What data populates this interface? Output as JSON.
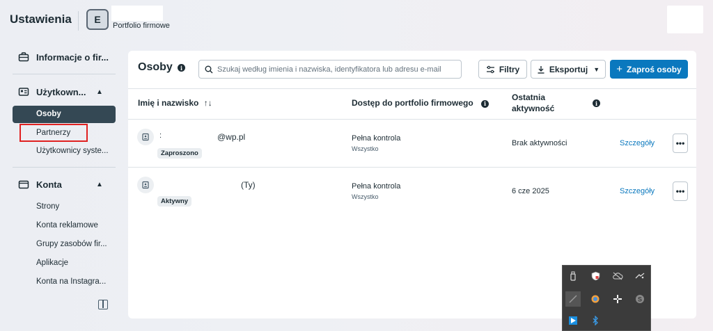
{
  "header": {
    "title": "Ustawienia",
    "avatar_letter": "E",
    "portfolio_label": "Portfolio firmowe"
  },
  "sidebar": {
    "business_info": "Informacje o fir...",
    "users_section": "Użytkown...",
    "users_items": [
      "Osoby",
      "Partnerzy",
      "Użytkownicy syste..."
    ],
    "accounts_section": "Konta",
    "accounts_items": [
      "Strony",
      "Konta reklamowe",
      "Grupy zasobów fir...",
      "Aplikacje",
      "Konta na Instagra..."
    ]
  },
  "panel": {
    "title": "Osoby",
    "search_placeholder": "Szukaj według imienia i nazwiska, identyfikatora lub adresu e-mail",
    "filters_label": "Filtry",
    "export_label": "Eksportuj",
    "invite_label": "Zaproś osoby",
    "columns": {
      "name": "Imię i nazwisko",
      "name_sort": "↑↓",
      "access": "Dostęp do portfolio firmowego",
      "last_activity_1": "Ostatnia",
      "last_activity_2": "aktywność"
    },
    "rows": [
      {
        "prefix": ":",
        "email": "@wp.pl",
        "status": "Zaproszono",
        "access": "Pełna kontrola",
        "access_sub": "Wszystko",
        "last_activity": "Brak aktywności",
        "details": "Szczegóły",
        "more": "•••"
      },
      {
        "prefix": "",
        "email": "(Ty)",
        "status": "Aktywny",
        "access": "Pełna kontrola",
        "access_sub": "Wszystko",
        "last_activity": "6 cze 2025",
        "details": "Szczegóły",
        "more": "•••"
      }
    ]
  },
  "colors": {
    "accent": "#0a78be",
    "active_nav": "#344854",
    "highlight_border": "#e02020",
    "tray_bg": "#3b3b3b"
  }
}
